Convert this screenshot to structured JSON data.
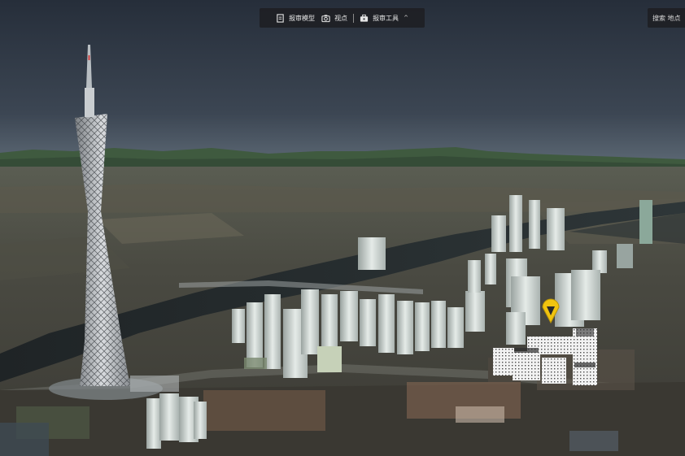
{
  "toolbar": {
    "model_label": "报审模型",
    "viewpoint_label": "视点",
    "tools_label": "报审工具",
    "tools_chevron": "^"
  },
  "search": {
    "placeholder": "搜索 地点"
  },
  "colors": {
    "toolbar_bg": "#1e2024",
    "marker": "#f1c40f",
    "sky_top": "#2b3442",
    "sky_horizon": "#5b6773"
  },
  "icons": [
    "document-icon",
    "camera-icon",
    "toolbox-icon",
    "chevron-up-icon",
    "location-pin-icon"
  ]
}
